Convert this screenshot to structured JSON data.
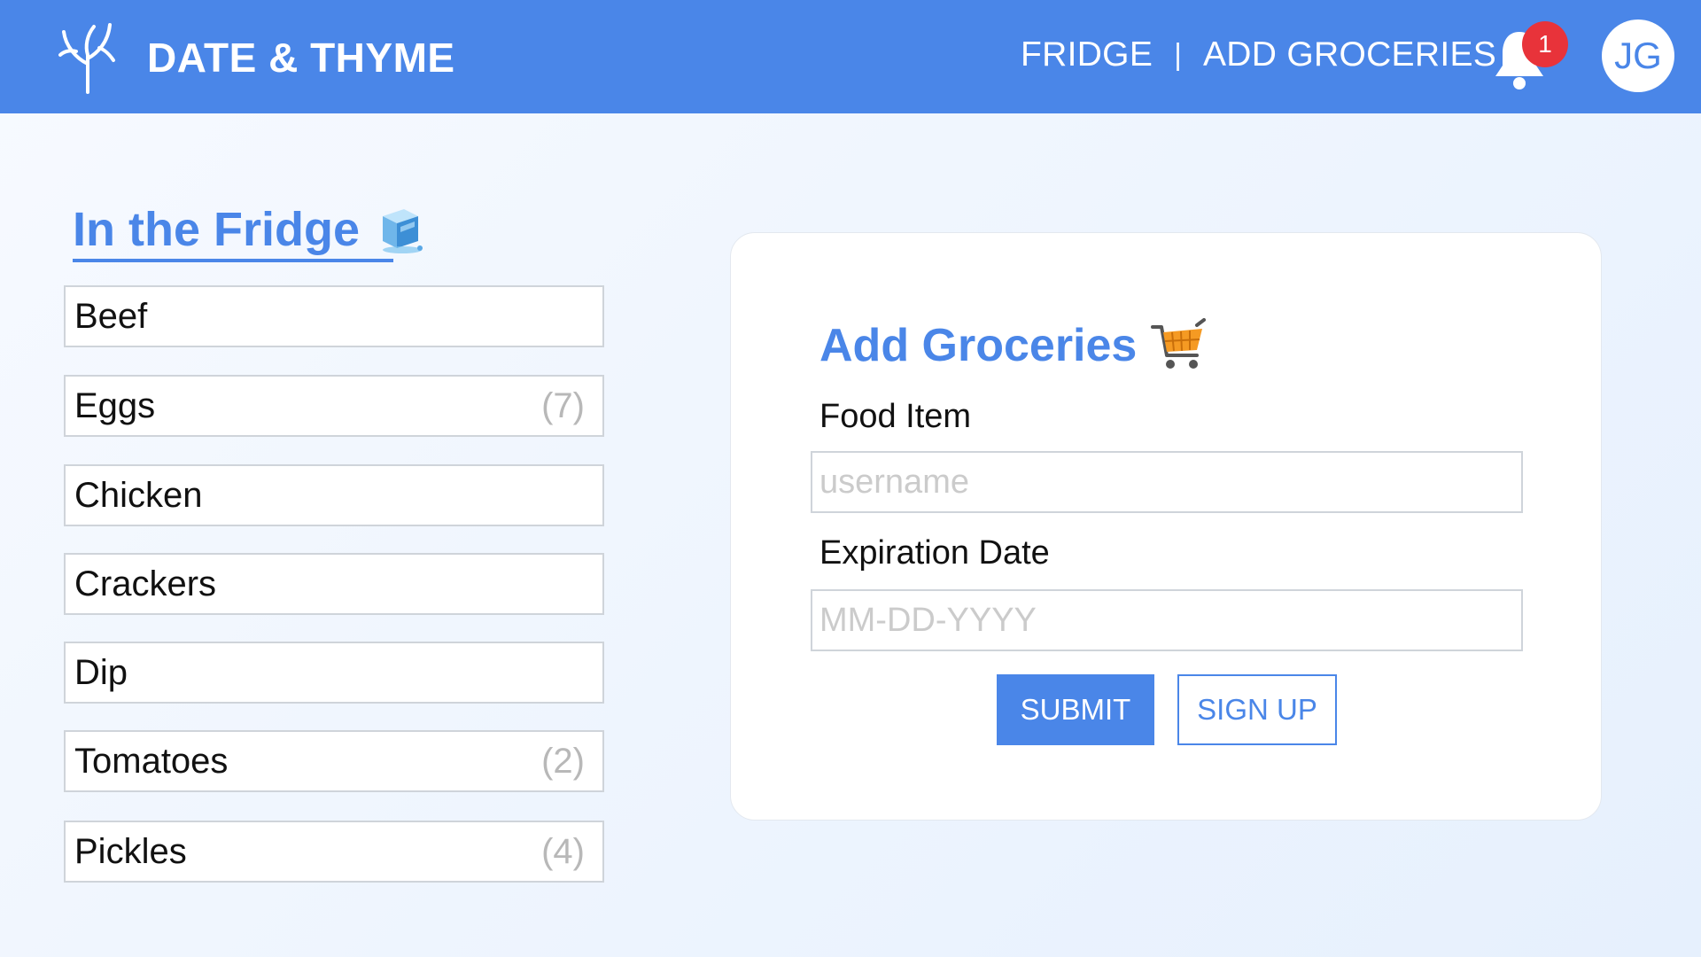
{
  "header": {
    "brand": "DATE & THYME",
    "logo_icon": "sprout-icon",
    "nav": [
      {
        "label": "FRIDGE"
      },
      {
        "label": "ADD GROCERIES"
      }
    ],
    "nav_separator": "|",
    "notification_icon": "bell-icon",
    "notification_count": "1",
    "avatar_initials": "JG"
  },
  "fridge": {
    "title": "In the Fridge",
    "title_icon": "ice-cube-icon",
    "items": [
      {
        "name": "Beef",
        "count": ""
      },
      {
        "name": "Eggs",
        "count": "(7)"
      },
      {
        "name": "Chicken",
        "count": ""
      },
      {
        "name": "Crackers",
        "count": ""
      },
      {
        "name": "Dip",
        "count": ""
      },
      {
        "name": "Tomatoes",
        "count": "(2)"
      },
      {
        "name": "Pickles",
        "count": "(4)"
      }
    ]
  },
  "form": {
    "title": "Add Groceries",
    "title_icon": "shopping-cart-icon",
    "food_label": "Food Item",
    "food_placeholder": "username",
    "date_label": "Expiration Date",
    "date_placeholder": "MM-DD-YYYY",
    "submit_label": "SUBMIT",
    "signup_label": "SIGN UP"
  },
  "colors": {
    "accent": "#4a86e8",
    "badge": "#e8333a"
  }
}
